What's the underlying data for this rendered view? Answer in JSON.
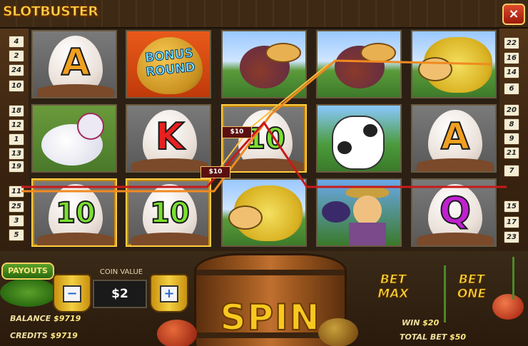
{
  "app": {
    "logo": "SLOTBUSTER",
    "close_label": "×"
  },
  "paylines": {
    "left": [
      "4",
      "2",
      "24",
      "10",
      "18",
      "12",
      "1",
      "13",
      "19",
      "11",
      "25",
      "3",
      "5"
    ],
    "right": [
      "22",
      "16",
      "14",
      "6",
      "20",
      "8",
      "9",
      "21",
      "7",
      "15",
      "17",
      "23"
    ]
  },
  "reels": [
    [
      {
        "symbol": "letter",
        "text": "A",
        "color": "#f0a020"
      },
      {
        "symbol": "hen",
        "text": ""
      },
      {
        "symbol": "ten",
        "text": "10",
        "color": "#7ae030",
        "win": true
      }
    ],
    [
      {
        "symbol": "bonus",
        "text": "BONUS ROUND"
      },
      {
        "symbol": "letter",
        "text": "K",
        "color": "#e82020"
      },
      {
        "symbol": "ten",
        "text": "10",
        "color": "#7ae030",
        "win": true
      }
    ],
    [
      {
        "symbol": "bird",
        "text": ""
      },
      {
        "symbol": "ten",
        "text": "10",
        "color": "#7ae030",
        "win": true
      },
      {
        "symbol": "sheep",
        "text": ""
      }
    ],
    [
      {
        "symbol": "bird",
        "text": ""
      },
      {
        "symbol": "cow",
        "text": ""
      },
      {
        "symbol": "scarecrow",
        "text": ""
      }
    ],
    [
      {
        "symbol": "sheep",
        "text": ""
      },
      {
        "symbol": "letter",
        "text": "A",
        "color": "#f0a020"
      },
      {
        "symbol": "letter",
        "text": "Q",
        "color": "#c020d0"
      }
    ]
  ],
  "win_tags": [
    "$10",
    "$10"
  ],
  "line_colors": {
    "orange": "#f08a20",
    "red": "#c81a1a",
    "yellow": "#ffc040"
  },
  "controls": {
    "payouts_label": "PAYOUTS",
    "coin_value_label": "COIN VALUE",
    "coin_value": "$2",
    "minus_label": "−",
    "plus_label": "+",
    "spin_label": "SPIN",
    "bet_max_label": "BET MAX",
    "bet_one_label": "BET ONE"
  },
  "stats": {
    "balance_label": "BALANCE",
    "balance_value": "$9719",
    "credits_label": "CREDITS",
    "credits_value": "$9719",
    "win_label": "WIN",
    "win_value": "$20",
    "total_bet_label": "TOTAL BET",
    "total_bet_value": "$50"
  }
}
